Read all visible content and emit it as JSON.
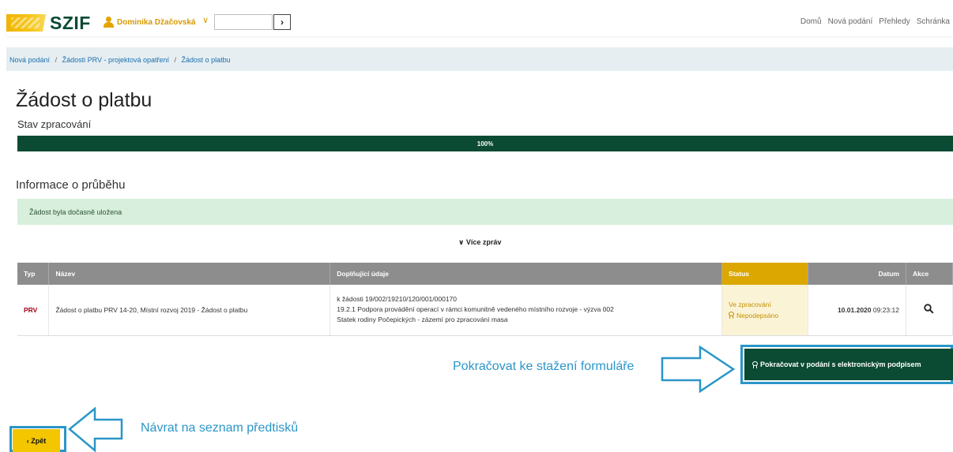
{
  "header": {
    "logo_text": "SZIF",
    "user_name": "Dominika Džačovská",
    "search_go": "›",
    "nav": [
      "Domů",
      "Nová podání",
      "Přehledy",
      "Schránka"
    ]
  },
  "breadcrumb": {
    "items": [
      "Nová podání",
      "Žádosti PRV - projektová opatření",
      "Žádost o platbu"
    ],
    "separator": "/"
  },
  "page": {
    "title": "Žádost o platbu",
    "progress_label": "Stav zpracování",
    "progress_value": 1.0,
    "progress_text": "100%"
  },
  "info": {
    "title": "Informace o průběhu",
    "alert": "Žádost byla dočasně uložena",
    "more_label": "Více zpráv",
    "more_icon": "chevron-down-icon"
  },
  "table": {
    "headers": {
      "typ": "Typ",
      "nazev": "Název",
      "doplnujici": "Doplňující údaje",
      "status": "Status",
      "datum": "Datum",
      "akce": "Akce"
    },
    "rows": [
      {
        "typ": "PRV",
        "nazev": "Žádost o platbu PRV 14-20, Místní rozvoj 2019 - Žádost o platbu",
        "detail1": "k žádosti 19/002/19210/120/001/000170",
        "detail2": "19.2.1 Podpora provádění operací v rámci komunitně vedeného místního rozvoje - výzva 002",
        "detail3": "Statek rodiny Počepických - zázemí pro zpracování masa",
        "status1": "Ve zpracování",
        "status2": "Nepodepsáno",
        "date": "10.01.2020",
        "time": "09:23:12",
        "action_icon": "search-icon"
      }
    ]
  },
  "actions": {
    "sign_button": "Pokračovat v podání s elektronickým podpisem",
    "back_button": "Zpět",
    "hint_right": "Pokračovat ke stažení formuláře",
    "hint_left": "Návrat na seznam předtisků"
  },
  "colors": {
    "brand_green": "#0b4a33",
    "brand_yellow": "#f3c600",
    "annotation_blue": "#2a96c8",
    "status_header": "#dba700",
    "typ_red": "#a50016"
  }
}
